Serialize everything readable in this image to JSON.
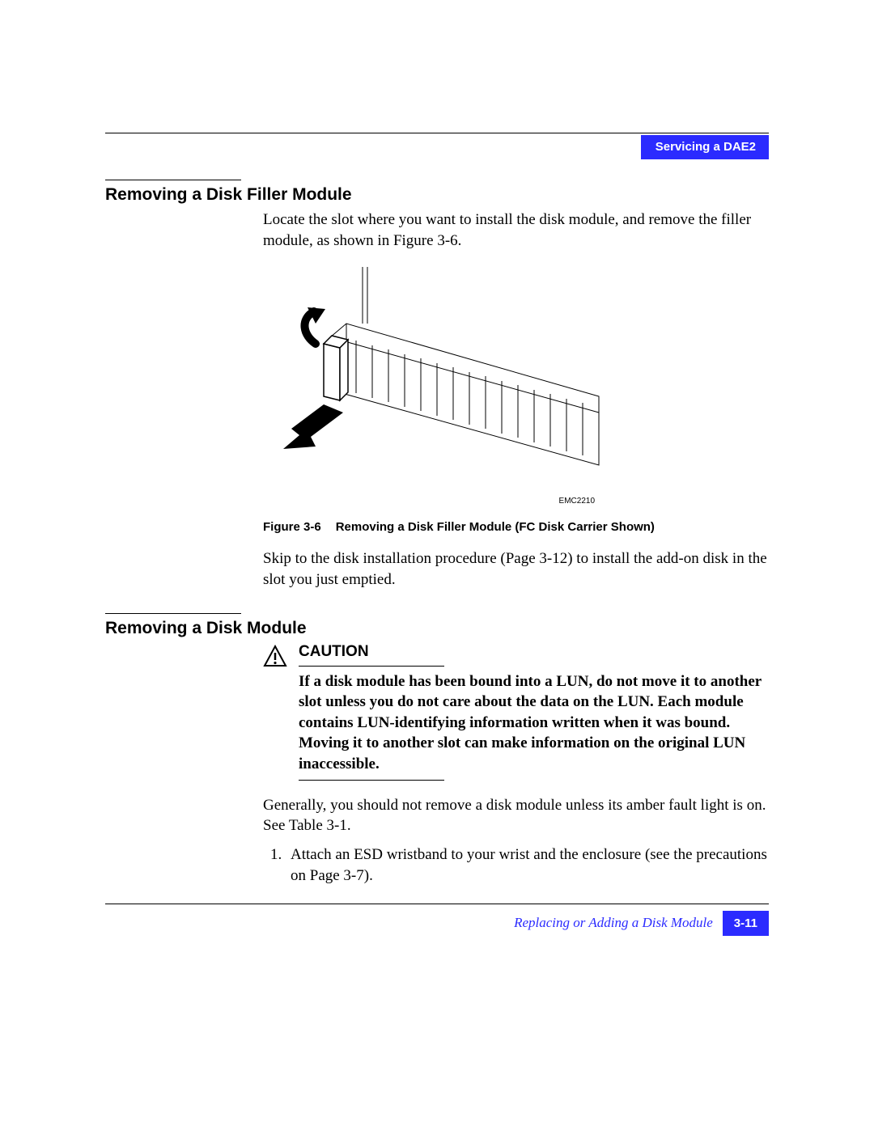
{
  "header": {
    "tab": "Servicing a DAE2"
  },
  "section1": {
    "heading": "Removing a Disk Filler Module",
    "p1": "Locate the slot where you want to install the disk module, and remove the filler module, as shown in Figure 3-6.",
    "figure_id": "EMC2210",
    "figure_num": "Figure 3-6",
    "figure_caption": "Removing a Disk Filler Module (FC Disk Carrier Shown)",
    "p2": "Skip to the disk installation procedure (Page 3-12) to install the add-on disk in the slot you just emptied."
  },
  "section2": {
    "heading": "Removing a Disk Module",
    "caution_word": "CAUTION",
    "caution_text": "If a disk module has been bound into a LUN, do not move it to another slot unless you do not care about the data on the LUN. Each module contains LUN-identifying information written when it was bound. Moving it to another slot can make information on the original LUN inaccessible.",
    "p1": "Generally, you should not remove a disk module unless its amber fault light is on. See Table 3-1.",
    "step1": "Attach an ESD wristband to your wrist and the enclosure (see the precautions on Page 3-7)."
  },
  "footer": {
    "title": "Replacing or Adding a Disk Module",
    "page": "3-11"
  }
}
